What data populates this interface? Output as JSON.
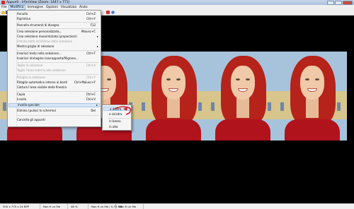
{
  "window": {
    "title": "Appunti - IrfanView (Zoom: 1447 x 771)"
  },
  "menubar": {
    "items": [
      "File",
      "Modifica",
      "Immagine",
      "Opzioni",
      "Visualizza",
      "Aiuto"
    ],
    "active_index": 1
  },
  "edit_menu": {
    "items": [
      {
        "label": "Annulla",
        "shortcut": "Ctrl+Z",
        "disabled": false
      },
      {
        "label": "Ripristina",
        "shortcut": "Ctrl+Y",
        "disabled": false
      },
      {
        "label": "Pannello strumenti di disegno",
        "shortcut": "F12",
        "disabled": false
      },
      {
        "label": "Crea selezione personalizzata...",
        "shortcut": "Maiusc+C",
        "disabled": false
      },
      {
        "label": "Crea selezione massimizzata (proporzioni)",
        "shortcut": "",
        "disabled": false,
        "submenu": true
      },
      {
        "label": "Elimina tutto all'interno della selezione",
        "shortcut": "",
        "disabled": true
      },
      {
        "label": "Mostra griglia di selezione",
        "shortcut": "",
        "disabled": false,
        "submenu": true
      },
      {
        "label": "Inserisci testo nella selezione...",
        "shortcut": "Ctrl+T",
        "disabled": false
      },
      {
        "label": "Inserisci immagine (sovrapposta/filigrana...",
        "shortcut": "",
        "disabled": false
      },
      {
        "label": "Taglia la selezione",
        "shortcut": "Ctrl+X",
        "disabled": true
      },
      {
        "label": "Taglia l'area esterna alla selezione",
        "shortcut": "",
        "disabled": true
      },
      {
        "label": "Ritaglia la selezione",
        "shortcut": "Ctrl+Y",
        "disabled": true
      },
      {
        "label": "Ritaglio automatico intorno ai bordi",
        "shortcut": "Ctrl+Maiusc+Y",
        "disabled": false
      },
      {
        "label": "Cattura l'area visibile della finestra",
        "shortcut": "",
        "disabled": false
      },
      {
        "label": "Copia",
        "shortcut": "Ctrl+C",
        "disabled": false
      },
      {
        "label": "Incolla",
        "shortcut": "Ctrl+V",
        "disabled": false
      },
      {
        "label": "Incolla speciale",
        "shortcut": "",
        "disabled": false,
        "submenu": true,
        "highlighted": true
      },
      {
        "label": "Elimina (pulisci lo schermo)",
        "shortcut": "Del",
        "disabled": false
      },
      {
        "label": "Cancella gli appunti",
        "shortcut": "",
        "disabled": false
      }
    ]
  },
  "paste_special_submenu": {
    "items": [
      "a destra",
      "a sinistra",
      "in basso",
      "in alto"
    ],
    "highlighted_index": 0
  },
  "statusbar": {
    "cells": [
      "300 x 770 x 24 BPP",
      "Non è un file",
      "48 %",
      "Non è un file / 0,75 MB",
      "Non è un file"
    ]
  },
  "colors": {
    "menu_highlight": "#d6e5f5",
    "annotation_red": "#e0202a",
    "canvas_bg": "#000000"
  }
}
